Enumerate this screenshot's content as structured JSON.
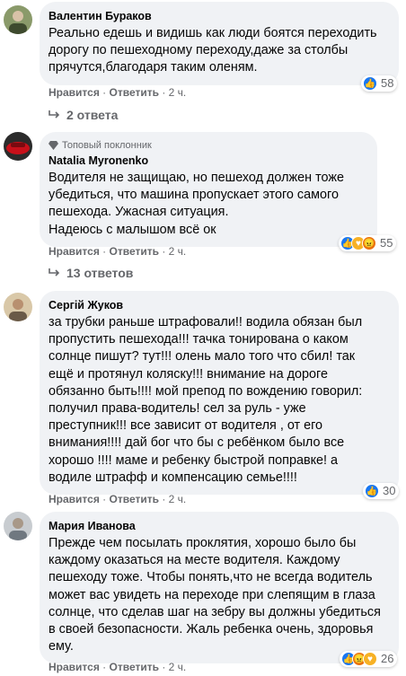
{
  "comments": [
    {
      "author": "Валентин Бураков",
      "badge": "",
      "lines": [
        "Реально едешь и видишь как люди боятся переходить",
        "дорогу по пешеходному переходу,даже за столбы",
        "прячутся,благодаря таким оленям."
      ],
      "like_label": "Нравится",
      "reply_label": "Ответить",
      "time": "2 ч.",
      "reactions": [
        "like"
      ],
      "reaction_count": "58",
      "replies_label": "2 ответа"
    },
    {
      "author": "Natalia Myronenko",
      "badge": "Топовый поклонник",
      "lines": [
        "Водителя не защищаю, но пешеход должен тоже",
        "убедиться, что машина пропускает этого самого",
        "пешехода. Ужасная ситуация.",
        "Надеюсь с малышом всё ок"
      ],
      "like_label": "Нравится",
      "reply_label": "Ответить",
      "time": "2 ч.",
      "reactions": [
        "like",
        "care",
        "angry"
      ],
      "reaction_count": "55",
      "replies_label": "13 ответов"
    },
    {
      "author": "Сергій Жуков",
      "badge": "",
      "lines": [
        "за трубки раньше штрафовали!! водила обязан был",
        "пропустить пешехода!!! тачка тонирована о каком",
        "солнце пишут? тут!!! олень мало того что сбил! так",
        "ещё и протянул коляску!!! внимание на дороге",
        "обязанно быть!!!! мой препод по вождению говорил:",
        "получил права-водитель! сел за руль - уже",
        "преступник!!! все зависит от водителя , от его",
        "внимания!!!! дай бог что бы с ребёнком было все",
        "хорошо !!!! маме и ребенку быстрой поправке! а",
        "водиле штрафф и компенсацию семье!!!!"
      ],
      "like_label": "Нравится",
      "reply_label": "Ответить",
      "time": "2 ч.",
      "reactions": [
        "like"
      ],
      "reaction_count": "30",
      "replies_label": ""
    },
    {
      "author": "Мария Иванова",
      "badge": "",
      "lines": [
        "Прежде чем посылать проклятия, хорошо было бы",
        "каждому оказаться на месте водителя. Каждому",
        "пешеходу тоже. Чтобы понять,что не всегда водитель",
        "может вас увидеть на переходе при слепящим в глаза",
        "солнце, что сделав шаг на зебру вы должны убедиться",
        "в своей безопасности. Жаль ребенка очень, здоровья",
        "ему."
      ],
      "like_label": "Нравится",
      "reply_label": "Ответить",
      "time": "2 ч.",
      "reactions": [
        "like",
        "angry",
        "care"
      ],
      "reaction_count": "26",
      "replies_label": ""
    }
  ],
  "separator": "·"
}
